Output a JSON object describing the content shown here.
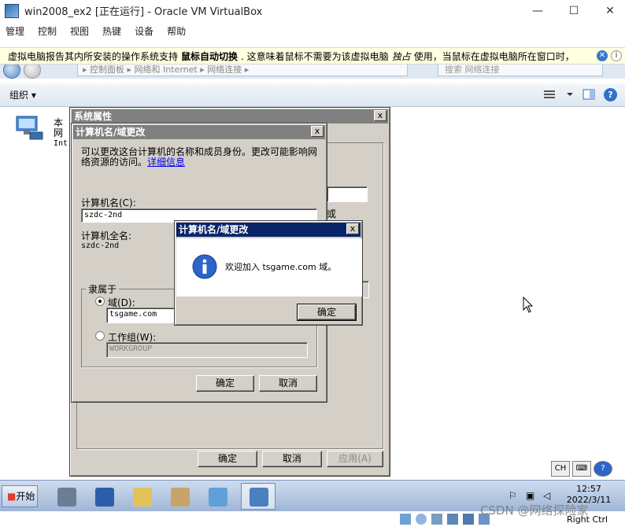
{
  "host": {
    "title": "win2008_ex2 [正在运行] - Oracle VM VirtualBox",
    "minimize": "—",
    "maximize": "☐",
    "close": "✕",
    "menu": [
      "管理",
      "控制",
      "视图",
      "热键",
      "设备",
      "帮助"
    ]
  },
  "notification": {
    "text_before": "虚拟电脑报告其内所安装的操作系统支持",
    "bold": "鼠标自动切换",
    "text_after": ". 这意味着鼠标不需要为该虚拟电脑",
    "italic": "独占",
    "text_end": "使用，当鼠标在虚拟电脑所在窗口时，"
  },
  "explorer": {
    "breadcrumb": "▸ 控制面板 ▸ 网络和 Internet ▸ 网络连接 ▸",
    "search_placeholder": "搜索 网络连接",
    "organize": "组织 ▾",
    "help": "?",
    "item_line1": "本",
    "item_line2": "网",
    "item_line3": "Int"
  },
  "sysprops": {
    "title": "系统属性",
    "close": "x",
    "ok": "确定",
    "cancel": "取消",
    "apply": "应用(A)",
    "partial_text": "或"
  },
  "rename": {
    "title": "计算机名/域更改",
    "close": "x",
    "description": "可以更改这台计算机的名称和成员身份。更改可能影响网络资源的访问。",
    "details_link": "详细信息",
    "computer_name_label": "计算机名(C):",
    "computer_name_value": "szdc-2nd",
    "full_name_label": "计算机全名:",
    "full_name_value": "szdc-2nd",
    "member_of": "隶属于",
    "domain_label": "域(D):",
    "domain_value": "tsgame.com",
    "workgroup_label": "工作组(W):",
    "workgroup_value": "WORKGROUP",
    "ok": "确定",
    "cancel": "取消"
  },
  "welcome": {
    "title": "计算机名/域更改",
    "close": "x",
    "message": "欢迎加入 tsgame.com 域。",
    "ok": "确定"
  },
  "taskbar": {
    "start": "开始",
    "lang": "CH",
    "time": "12:57",
    "date": "2022/3/11"
  },
  "status": {
    "host_key": "Right Ctrl",
    "watermark": "CSDN @网络探险家"
  }
}
